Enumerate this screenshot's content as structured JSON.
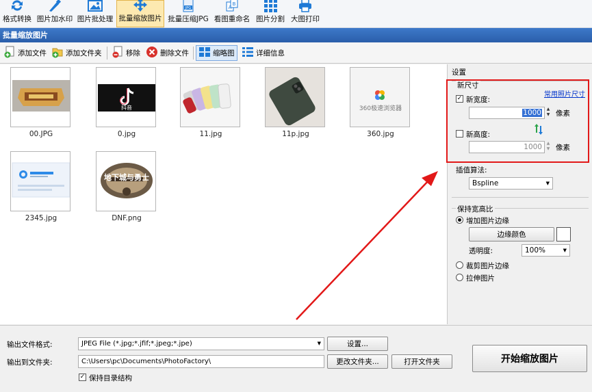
{
  "ribbon": {
    "items": [
      {
        "label": "格式转换",
        "icon": "convert-icon"
      },
      {
        "label": "图片加水印",
        "icon": "watermark-icon"
      },
      {
        "label": "图片批处理",
        "icon": "batch-process-icon"
      },
      {
        "label": "批量缩放图片",
        "icon": "resize-icon"
      },
      {
        "label": "批量压缩JPG",
        "icon": "compress-jpg-icon"
      },
      {
        "label": "看图重命名",
        "icon": "rename-icon"
      },
      {
        "label": "图片分割",
        "icon": "split-icon"
      },
      {
        "label": "大图打印",
        "icon": "print-icon"
      }
    ]
  },
  "title": "批量缩放图片",
  "toolbar": {
    "add_file": "添加文件",
    "add_folder": "添加文件夹",
    "remove": "移除",
    "delete_file": "删除文件",
    "thumbnail": "缩略图",
    "details": "详细信息"
  },
  "files": [
    {
      "name": "00.JPG"
    },
    {
      "name": "0.jpg"
    },
    {
      "name": "11.jpg"
    },
    {
      "name": "11p.jpg"
    },
    {
      "name": "360.jpg"
    },
    {
      "name": "2345.jpg"
    },
    {
      "name": "DNF.png"
    }
  ],
  "thumb_text": {
    "tiktok": "抖音",
    "browser360": "360极速浏览器",
    "dnf": "地下城与勇士"
  },
  "settings": {
    "heading": "设置",
    "new_size": "新尺寸",
    "common_sizes_link": "常用照片尺寸",
    "new_width_label": "新宽度:",
    "new_width_value": "1000",
    "new_height_label": "新高度:",
    "new_height_value": "1000",
    "unit": "像素",
    "interp_label": "插值算法:",
    "interp_value": "Bspline",
    "keep_ratio_label": "保持宽高比",
    "add_border": "增加图片边缘",
    "border_color_button": "边缘颜色",
    "opacity_label": "透明度:",
    "opacity_value": "100%",
    "crop_border": "裁剪图片边缘",
    "stretch": "拉伸图片"
  },
  "bottom": {
    "format_label": "输出文件格式:",
    "format_value": "JPEG File (*.jpg;*.jfif;*.jpeg;*.jpe)",
    "settings_button": "设置...",
    "output_label": "输出到文件夹:",
    "output_value": "C:\\Users\\pc\\Documents\\PhotoFactory\\",
    "change_folder_button": "更改文件夹...",
    "open_folder_button": "打开文件夹",
    "keep_structure": "保持目录结构",
    "start_button": "开始缩放图片"
  },
  "colors": {
    "title_bar": "#2f66b3",
    "highlight": "#e21818",
    "link": "#0033cc"
  }
}
